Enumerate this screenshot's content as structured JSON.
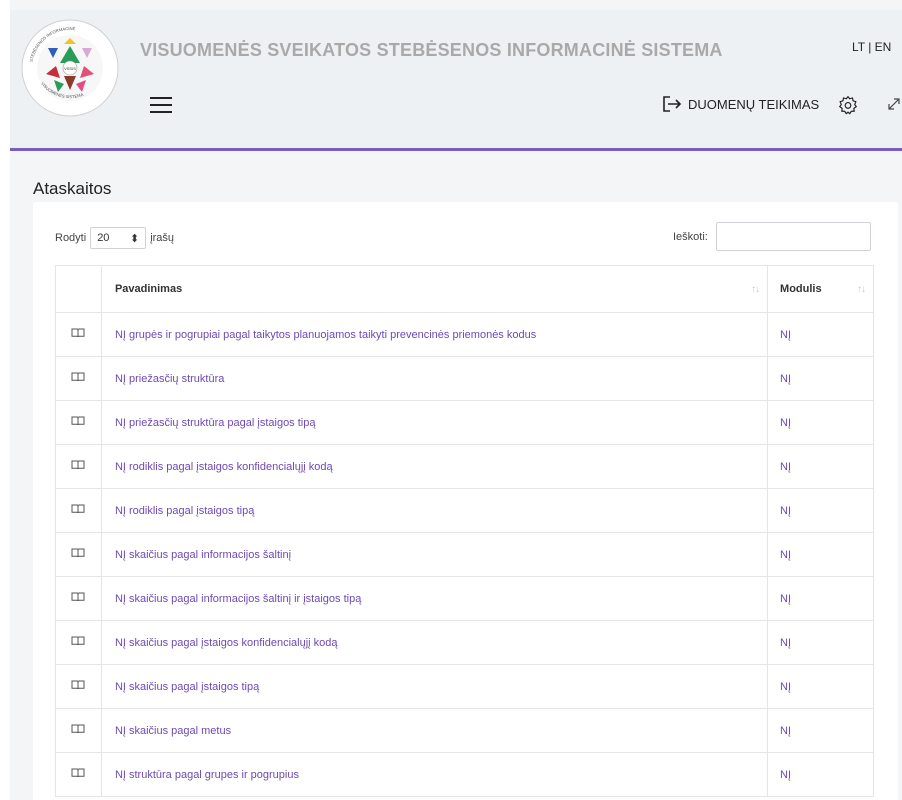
{
  "header": {
    "title": "VISUOMENĖS SVEIKATOS STEBĖSENOS INFORMACINĖ SISTEMA",
    "lang": "LT | EN",
    "data_button": "DUOMENŲ TEIKIMAS",
    "logo_text": "VISUOMENĖS SVEIKATOS STEBĖSENOS INFORMACINĖ SISTEMA",
    "logo_center": "VSSIS"
  },
  "page": {
    "title": "Ataskaitos"
  },
  "controls": {
    "show_label": "Rodyti",
    "page_size": "20",
    "entries_label": "įrašų",
    "search_label": "Ieškoti:",
    "search_value": ""
  },
  "table": {
    "headers": {
      "name": "Pavadinimas",
      "module": "Modulis"
    },
    "rows": [
      {
        "name": "NĮ grupės ir pogrupiai pagal taikytos planuojamos taikyti prevencinės priemonės kodus",
        "module": "NĮ"
      },
      {
        "name": "NĮ priežasčių struktūra",
        "module": "NĮ"
      },
      {
        "name": "NĮ priežasčių struktūra pagal įstaigos tipą",
        "module": "NĮ"
      },
      {
        "name": "NĮ rodiklis pagal įstaigos konfidencialųjį kodą",
        "module": "NĮ"
      },
      {
        "name": "NĮ rodiklis pagal įstaigos tipą",
        "module": "NĮ"
      },
      {
        "name": "NĮ skaičius pagal informacijos šaltinį",
        "module": "NĮ"
      },
      {
        "name": "NĮ skaičius pagal informacijos šaltinį ir įstaigos tipą",
        "module": "NĮ"
      },
      {
        "name": "NĮ skaičius pagal įstaigos konfidencialųjį kodą",
        "module": "NĮ"
      },
      {
        "name": "NĮ skaičius pagal įstaigos tipą",
        "module": "NĮ"
      },
      {
        "name": "NĮ skaičius pagal metus",
        "module": "NĮ"
      },
      {
        "name": "NĮ struktūra pagal grupes ir pogrupius",
        "module": "NĮ"
      }
    ]
  },
  "colors": {
    "accent": "#7a5bbf",
    "link": "#6e49b5",
    "header_bg": "#eef1f4"
  }
}
